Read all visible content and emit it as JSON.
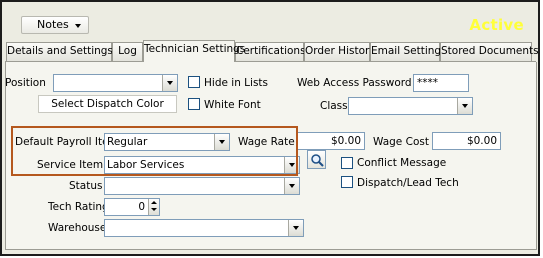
{
  "header": {
    "notes_label": "Notes",
    "status": "Active"
  },
  "tabs": [
    {
      "label": "Details and Settings"
    },
    {
      "label": "Log"
    },
    {
      "label": "Technician Settings",
      "active": true
    },
    {
      "label": "Certifications"
    },
    {
      "label": "Order History"
    },
    {
      "label": "Email Settings"
    },
    {
      "label": "Stored Documents"
    }
  ],
  "form": {
    "position": {
      "label": "Position",
      "value": ""
    },
    "hide_in_lists": {
      "label": "Hide in Lists",
      "checked": false
    },
    "web_access_password": {
      "label": "Web Access Password",
      "value": "****"
    },
    "select_dispatch_color": {
      "label": "Select Dispatch Color"
    },
    "white_font": {
      "label": "White Font",
      "checked": false
    },
    "class": {
      "label": "Class",
      "value": ""
    },
    "default_payroll_item": {
      "label": "Default Payroll Item",
      "value": "Regular"
    },
    "wage_rate": {
      "label": "Wage Rate",
      "value": "$0.00"
    },
    "wage_cost": {
      "label": "Wage Cost",
      "value": "$0.00"
    },
    "service_item": {
      "label": "Service Item",
      "value": "Labor Services"
    },
    "conflict_message": {
      "label": "Conflict Message",
      "checked": false
    },
    "status": {
      "label": "Status",
      "value": ""
    },
    "dispatch_lead_tech": {
      "label": "Dispatch/Lead Tech",
      "checked": false
    },
    "tech_rating": {
      "label": "Tech Rating",
      "value": "0"
    },
    "warehouse": {
      "label": "Warehouse",
      "value": ""
    }
  },
  "colors": {
    "status_text": "#ffff3a",
    "highlight_box": "#b5581e",
    "panel_bg": "#f5f5ef"
  }
}
